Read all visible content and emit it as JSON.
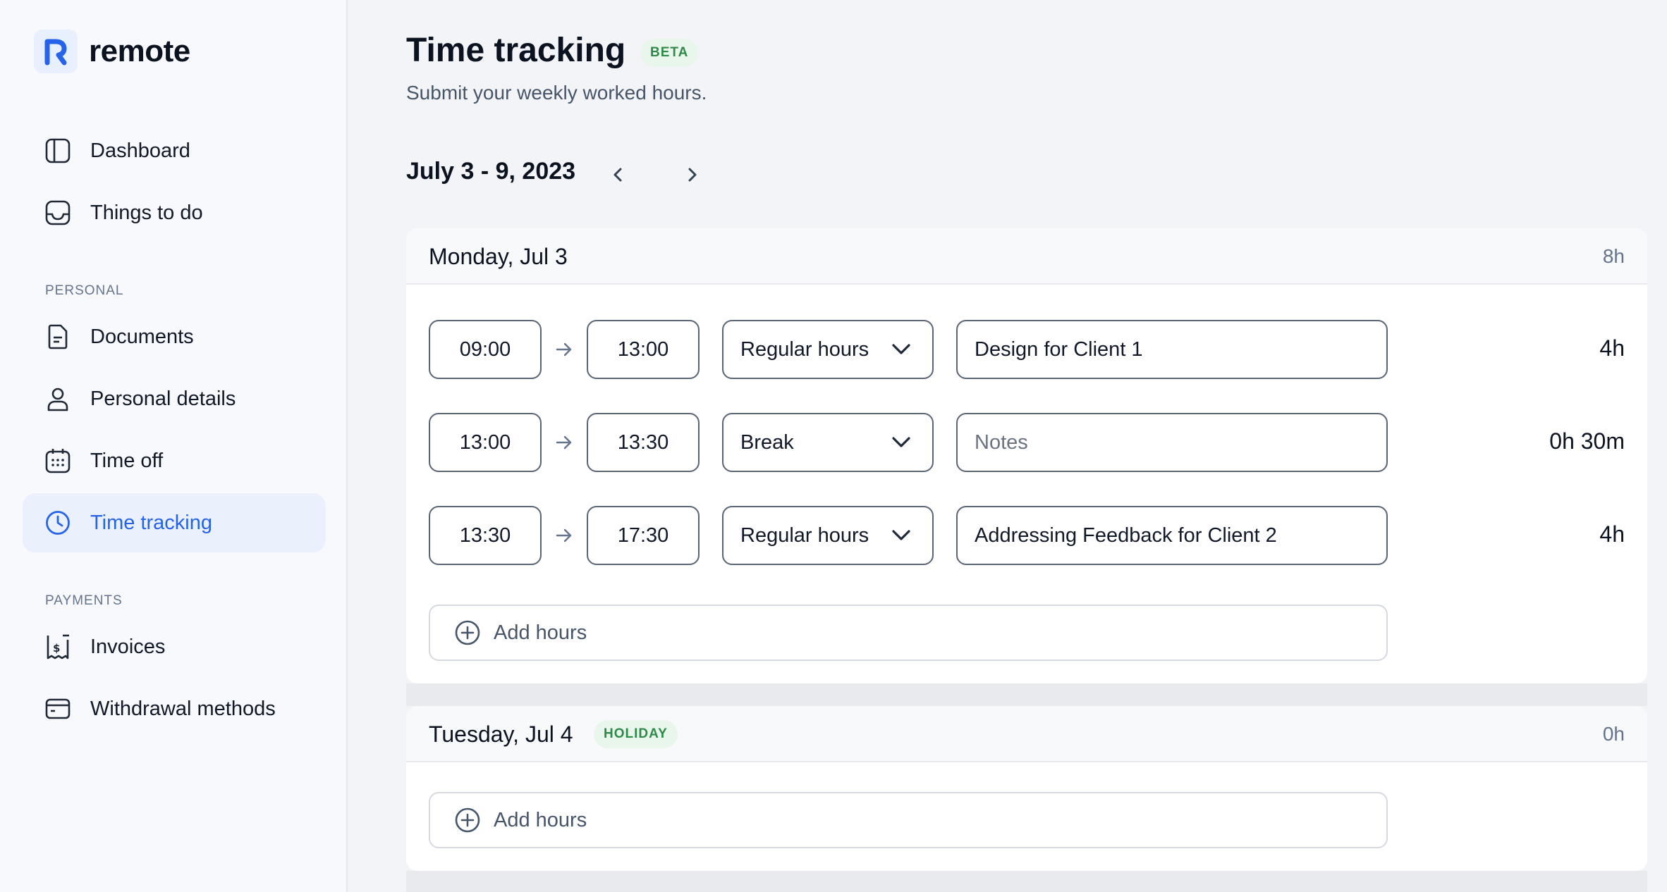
{
  "app": {
    "name": "remote",
    "brand_color": "#2563eb"
  },
  "sidebar": {
    "items_top": [
      {
        "label": "Dashboard",
        "icon": "dashboard-icon"
      },
      {
        "label": "Things to do",
        "icon": "inbox-icon"
      }
    ],
    "personal_label": "PERSONAL",
    "personal_items": [
      {
        "label": "Documents",
        "icon": "document-icon"
      },
      {
        "label": "Personal details",
        "icon": "user-icon"
      },
      {
        "label": "Time off",
        "icon": "calendar-icon"
      },
      {
        "label": "Time tracking",
        "icon": "clock-icon",
        "active": true
      }
    ],
    "payments_label": "PAYMENTS",
    "payments_items": [
      {
        "label": "Invoices",
        "icon": "invoice-icon"
      },
      {
        "label": "Withdrawal methods",
        "icon": "card-icon"
      }
    ]
  },
  "header": {
    "title": "Time tracking",
    "badge": "BETA",
    "subtitle": "Submit your weekly worked hours."
  },
  "week": {
    "label": "July 3 - 9, 2023"
  },
  "days": [
    {
      "title": "Monday, Jul 3",
      "total": "8h",
      "entries": [
        {
          "start": "09:00",
          "end": "13:00",
          "type": "Regular hours",
          "note": "Design for Client 1",
          "note_placeholder": false,
          "total": "4h"
        },
        {
          "start": "13:00",
          "end": "13:30",
          "type": "Break",
          "note": "Notes",
          "note_placeholder": true,
          "total": "0h 30m"
        },
        {
          "start": "13:30",
          "end": "17:30",
          "type": "Regular hours",
          "note": "Addressing Feedback for Client 2",
          "note_placeholder": false,
          "total": "4h"
        }
      ],
      "add_label": "Add hours"
    },
    {
      "title": "Tuesday, Jul 4",
      "badge": "HOLIDAY",
      "total": "0h",
      "entries": [],
      "add_label": "Add hours"
    }
  ]
}
